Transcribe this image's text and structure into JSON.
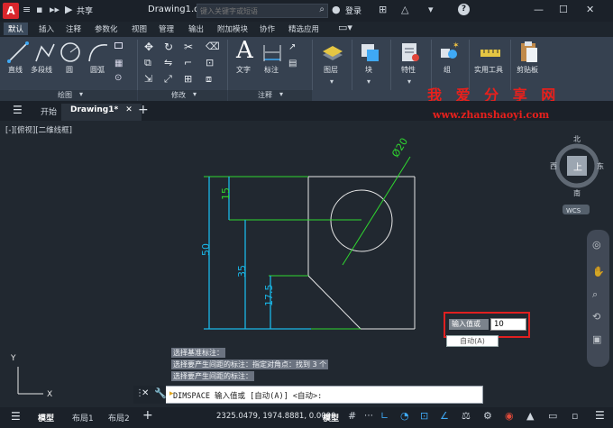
{
  "titlebar": {
    "app_logo": "A",
    "share_label": "共享",
    "doc_title": "Drawing1.dwg",
    "search_placeholder": "键入关键字或短语",
    "login_label": "登录",
    "help_label": "?"
  },
  "ribbon": {
    "tabs": [
      "默认",
      "插入",
      "注释",
      "参数化",
      "视图",
      "管理",
      "输出",
      "附加模块",
      "协作",
      "精选应用"
    ],
    "draw_tools": [
      "直线",
      "多段线",
      "圆",
      "圆弧"
    ],
    "annotation_tools": [
      "文字",
      "标注"
    ],
    "big_tools": [
      "图层",
      "块",
      "特性",
      "组",
      "实用工具",
      "剪贴板"
    ],
    "panels": [
      "绘图",
      "修改",
      "注释"
    ]
  },
  "watermark": {
    "text_cn": "我 爱 分 享 网",
    "url": "www.zhanshaoyi.com"
  },
  "doc_tabs": {
    "start": "开始",
    "drawing": "Drawing1*"
  },
  "viewport_label": "[-][俯视][二维线框]",
  "viewcube": {
    "north": "北",
    "south": "南",
    "east": "东",
    "west": "西",
    "top": "上",
    "wcs": "WCS"
  },
  "drawing": {
    "dim_diameter": "Ø20",
    "dim_15": "15",
    "dim_50": "50",
    "dim_35": "35",
    "dim_17_5": "17.5",
    "ucs_y": "Y",
    "ucs_x": "X",
    "colors": {
      "dim": "#19b7e8",
      "diameter": "#2fd72f",
      "extension": "#2fd72f",
      "object": "#e8e8e8"
    }
  },
  "dyn_input": {
    "label": "输入值或",
    "value": "10",
    "auto_option": "自动(A)"
  },
  "command": {
    "history": [
      "选择基准标注：",
      "选择要产生间距的标注：指定对角点：找到 3 个",
      "选择要产生间距的标注："
    ],
    "current": "DIMSPACE 输入值或 [自动(A)] <自动>:"
  },
  "status": {
    "model_tab": "模型",
    "layout1": "布局1",
    "layout2": "布局2",
    "coords": "2325.0479, 1974.8881, 0.0000",
    "mode": "模型"
  }
}
